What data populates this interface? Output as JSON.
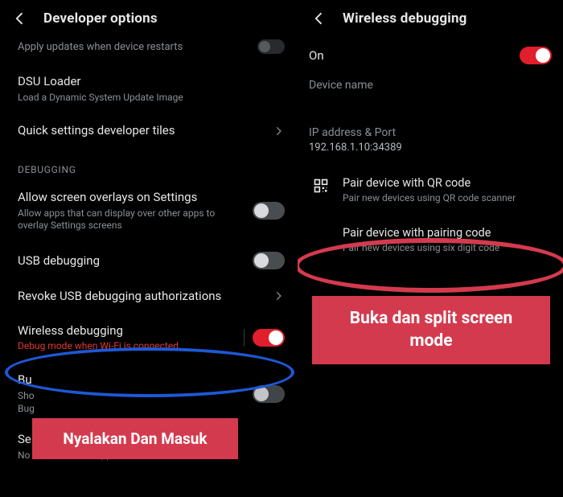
{
  "left": {
    "header_title": "Developer options",
    "apply_updates": {
      "title": "Apply updates when device restarts"
    },
    "dsu": {
      "title": "DSU Loader",
      "sub": "Load a Dynamic System Update Image"
    },
    "quick_tiles_title": "Quick settings developer tiles",
    "debug_label": "DEBUGGING",
    "overlays": {
      "title": "Allow screen overlays on Settings",
      "sub": "Allow apps that can display over other apps to overlay Settings screens"
    },
    "usb_debug_title": "USB debugging",
    "revoke_title": "Revoke USB debugging authorizations",
    "wireless": {
      "title": "Wireless debugging",
      "sub": "Debug mode when Wi-Fi is connected"
    },
    "bug_prefix": "Bu",
    "bug_sub1": "Sho",
    "bug_sub2": "Bug",
    "mock": {
      "title": "Select mock location app",
      "sub": "No mock location app set"
    }
  },
  "right": {
    "header_title": "Wireless debugging",
    "on_label": "On",
    "device_name_label": "Device name",
    "device_name_value": "",
    "ip_label": "IP address & Port",
    "ip_value": "192.168.1.10:34389",
    "pair_qr": {
      "title": "Pair device with QR code",
      "sub": "Pair new devices using QR code scanner"
    },
    "pair_code": {
      "title": "Pair device with pairing code",
      "sub": "Pair new devices using six digit code"
    }
  },
  "annotations": {
    "left_callout": "Nyalakan Dan Masuk",
    "right_callout": "Buka dan split screen mode"
  }
}
